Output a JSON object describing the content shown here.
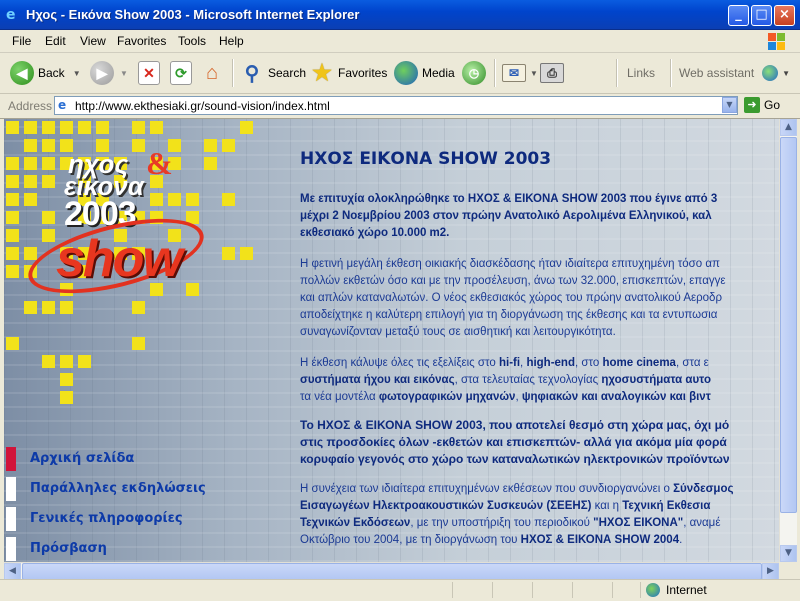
{
  "window": {
    "title": "Ηχος - Εικόνα Show 2003 - Microsoft Internet Explorer",
    "minimize": "_",
    "maximize": "□",
    "close": "×"
  },
  "menu": [
    "File",
    "Edit",
    "View",
    "Favorites",
    "Tools",
    "Help"
  ],
  "toolbar": {
    "back": "Back",
    "search": "Search",
    "favorites": "Favorites",
    "media": "Media",
    "links": "Links",
    "web_assistant": "Web assistant"
  },
  "address": {
    "label": "Address",
    "url": "http://www.ekthesiaki.gr/sound-vision/index.html",
    "go": "Go"
  },
  "logo": {
    "line1": "ηχος",
    "amp": "&",
    "line2": "εικονα",
    "year": "2003",
    "show": "show"
  },
  "nav": [
    {
      "label": "Αρχική σελίδα",
      "active": true
    },
    {
      "label": "Παράλληλες εκδηλώσεις",
      "active": false
    },
    {
      "label": "Γενικές πληροφορίες",
      "active": false
    },
    {
      "label": "Πρόσβαση",
      "active": false
    }
  ],
  "content": {
    "heading": "ΗΧΟΣ ΕΙΚΟΝΑ SHOW 2003",
    "p1": [
      "Με επιτυχία ολοκληρώθηκε το ΗΧΟΣ & ΕΙΚΟΝΑ SHOW 2003 που έγινε από 3",
      "μέχρι 2 Νοεμβρίου 2003 στον πρώην Ανατολικό Αερολιμένα Ελληνικού, καλ",
      "εκθεσιακό χώρο 10.000 m2."
    ],
    "p2": [
      "Η φετινή μεγάλη έκθεση οικιακής διασκέδασης ήταν ιδιαίτερα επιτυχημένη τόσο απ",
      "πολλών εκθετών όσο και με την προσέλευση, άνω των 32.000, επισκεπτών, επαγγε",
      "και απλών καταναλωτών. Ο νέος εκθεσιακός χώρος του πρώην ανατολικού Αεροδρ",
      "αποδείχτηκε η καλύτερη επιλογή για τη διοργάνωση της έκθεσης και τα εντυπωσια",
      "συναγωνίζονταν μεταξύ τους σε αισθητική και λειτουργικότητα."
    ],
    "p3": [
      {
        "parts": [
          [
            "Η έκθεση κάλυψε όλες τις εξελίξεις στο ",
            false
          ],
          [
            "hi-fi",
            true
          ],
          [
            ", ",
            false
          ],
          [
            "high-end",
            true
          ],
          [
            ", στο ",
            false
          ],
          [
            "home cinema",
            true
          ],
          [
            ", στα ε",
            false
          ]
        ]
      },
      {
        "parts": [
          [
            "συστήματα ήχου και εικόνας",
            true
          ],
          [
            ", στα τελευταίας τεχνολογίας ",
            false
          ],
          [
            "ηχοσυστήματα αυτο",
            true
          ]
        ]
      },
      {
        "parts": [
          [
            "τα νέα μοντέλα ",
            false
          ],
          [
            "φωτογραφικών μηχανών",
            true
          ],
          [
            ", ",
            false
          ],
          [
            "ψηφιακών και αναλογικών και βιντ",
            true
          ]
        ]
      }
    ],
    "p4": [
      "Το ΗΧΟΣ & ΕΙΚΟΝΑ SHOW 2003, που αποτελεί θεσμό στη χώρα μας, όχι μό",
      "στις προσδοκίες όλων -εκθετών και επισκεπτών- αλλά για ακόμα μία φορά",
      "κορυφαίο γεγονός στο χώρο των καταναλωτικών ηλεκτρονικών προϊόντων"
    ],
    "p5": [
      {
        "parts": [
          [
            "Η συνέχεια των ιδιαίτερα επιτυχημένων εκθέσεων που συνδιοργανώνει ο ",
            false
          ],
          [
            "Σύνδεσμος",
            true
          ]
        ]
      },
      {
        "parts": [
          [
            "Εισαγωγέων Ηλεκτροακουστικών Συσκευών (ΣΕΕΗΣ)",
            true
          ],
          [
            " και η ",
            false
          ],
          [
            "Τεχνική Εκθεσια",
            true
          ]
        ]
      },
      {
        "parts": [
          [
            "Τεχνικών Εκδόσεων",
            true
          ],
          [
            ", με την υποστήριξη του περιοδικού ",
            false
          ],
          [
            "\"ΗΧΟΣ ΕΙΚΟΝΑ\"",
            true
          ],
          [
            ", αναμέ",
            false
          ]
        ]
      },
      {
        "parts": [
          [
            "Οκτώβριο του 2004, με τη διοργάνωση του ",
            false
          ],
          [
            "ΗΧΟΣ & ΕΙΚΟΝΑ SHOW 2004",
            true
          ],
          [
            ".",
            false
          ]
        ]
      }
    ]
  },
  "status": {
    "zone": "Internet"
  },
  "colors": {
    "title_bar": "#0044cc",
    "link_blue": "#0d3aa8",
    "heading_navy": "#0e2a7e",
    "accent_yellow": "#f2e21a",
    "accent_red": "#d1143a"
  }
}
